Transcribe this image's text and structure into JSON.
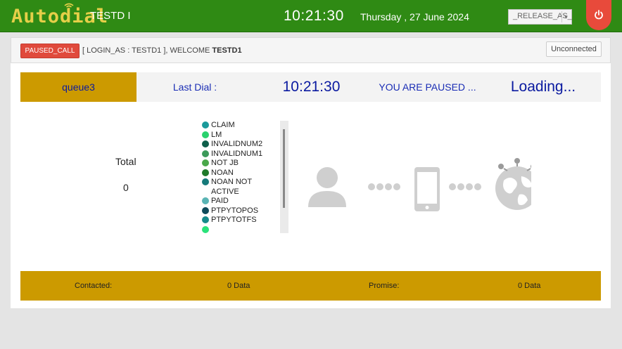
{
  "header": {
    "brand": "Autodial",
    "user_label": "TESTD I",
    "clock": "10:21:30",
    "date": "Thursday , 27 June 2024",
    "release_select": "_RELEASE_AS_",
    "brand_color": "#e5cf48",
    "bar_color": "#2f8a14",
    "power_icon": "power-icon"
  },
  "status": {
    "paused_button": "PAUSED_CALL",
    "login_prefix": "[ LOGIN_AS : TESTD1 ], WELCOME ",
    "login_user": "TESTD1",
    "unconnected_button": "Unconnected"
  },
  "info": {
    "queue": "queue3",
    "last_dial_label": "Last Dial :",
    "time": "10:21:30",
    "paused_text": "YOU ARE PAUSED ...",
    "loading_text": "Loading..."
  },
  "totals": {
    "label": "Total",
    "value": "0"
  },
  "dispositions": [
    {
      "label": "CLAIM",
      "color": "#1a9a9a"
    },
    {
      "label": "LM",
      "color": "#2ad26e"
    },
    {
      "label": "INVALIDNUM2",
      "color": "#0e5f4a"
    },
    {
      "label": "INVALIDNUM1",
      "color": "#3c9a5a"
    },
    {
      "label": "NOT JB",
      "color": "#4aa84a"
    },
    {
      "label": "NOAN",
      "color": "#1f7a2a"
    },
    {
      "label": "NOAN NOT ACTIVE",
      "color": "#157a7a"
    },
    {
      "label": "PAID",
      "color": "#5ab4b4"
    },
    {
      "label": "PTPYTOPOS",
      "color": "#0e4a5a"
    },
    {
      "label": "PTPYTOTFS",
      "color": "#168a8a"
    },
    {
      "label": "",
      "color": "#2ae27a"
    }
  ],
  "footer": {
    "contacted_label": "Contacted:",
    "contacted_value": "0 Data",
    "promise_label": "Promise:",
    "promise_value": "0 Data"
  }
}
